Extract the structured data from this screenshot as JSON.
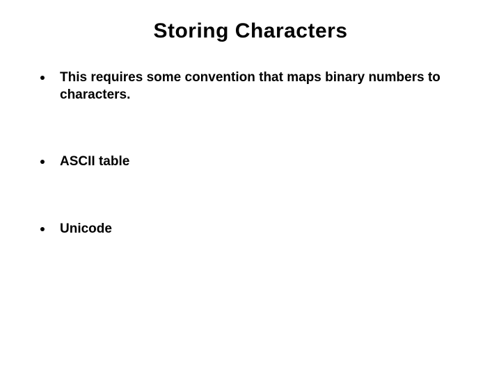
{
  "slide": {
    "title": "Storing Characters",
    "bullets": [
      {
        "text": "This requires some convention that maps binary numbers to characters."
      },
      {
        "text": "ASCII table"
      },
      {
        "text": "Unicode"
      }
    ]
  }
}
